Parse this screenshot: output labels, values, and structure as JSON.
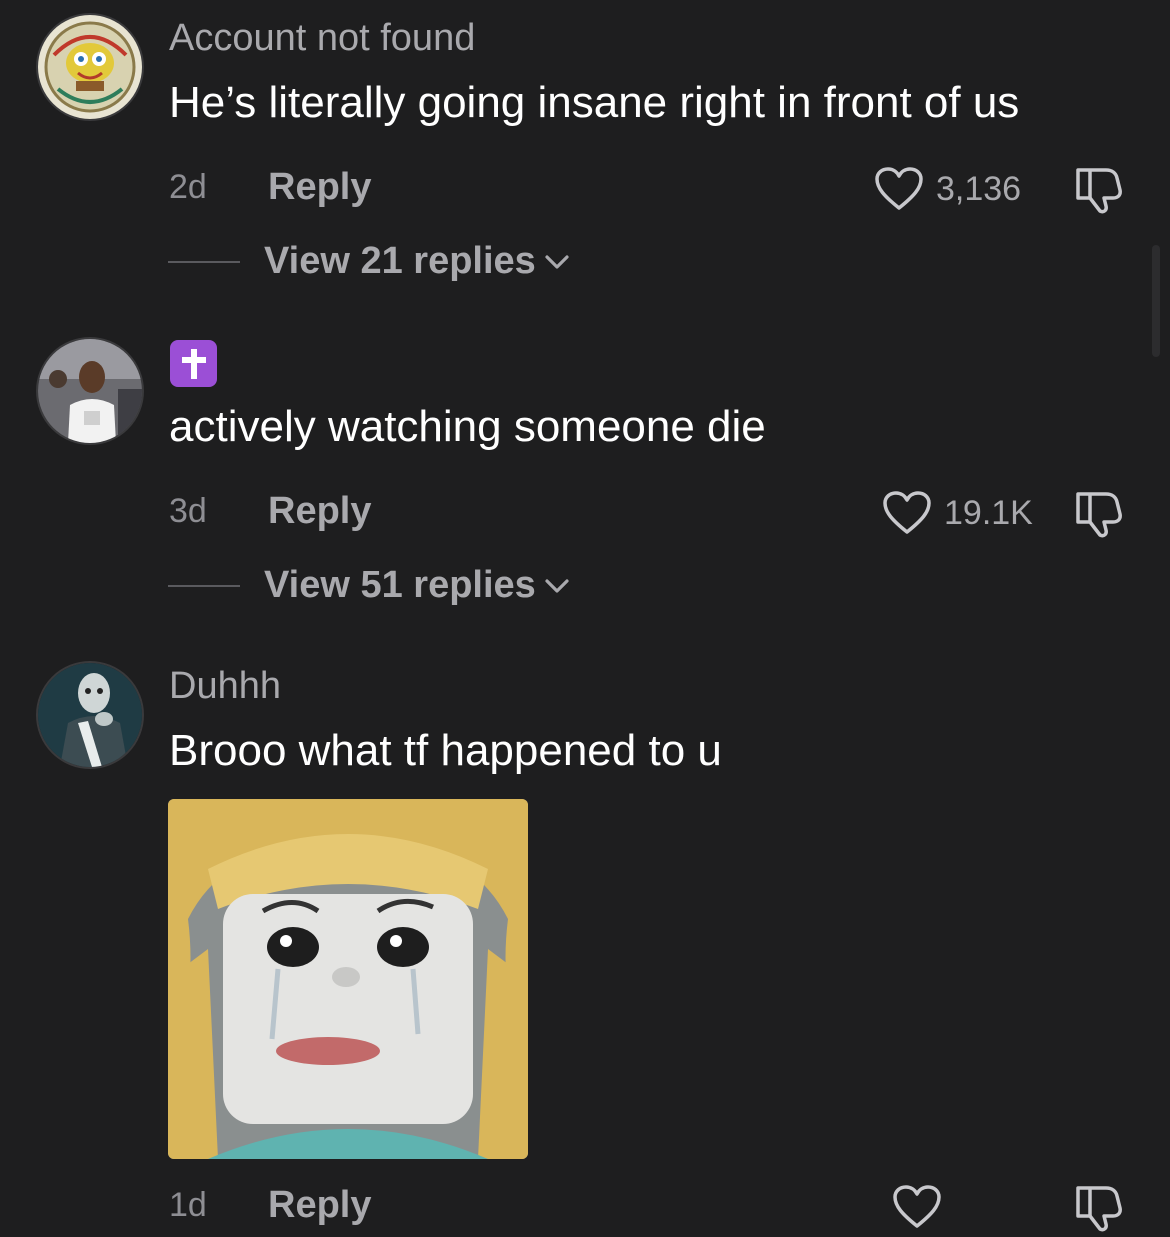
{
  "comments": [
    {
      "author": "Account not found",
      "text": "He’s literally going insane right in front of us",
      "time": "2d",
      "reply_label": "Reply",
      "likes": "3,136",
      "view_replies": "View 21 replies",
      "avatar": "spongebob-avatar"
    },
    {
      "author_emoji": "✝️",
      "text": "actively watching someone die",
      "time": "3d",
      "reply_label": "Reply",
      "likes": "19.1K",
      "view_replies": "View 51 replies",
      "avatar": "person-photo-avatar"
    },
    {
      "author": "Duhhh",
      "text": "Brooo what tf happened to u",
      "time": "1d",
      "reply_label": "Reply",
      "avatar": "anime-character-avatar",
      "attachment": "crying-roblox-character-image"
    }
  ],
  "icons": {
    "like": "heart-outline-icon",
    "dislike": "thumbs-down-icon",
    "expand": "chevron-down-icon"
  },
  "colors": {
    "background": "#1e1e1f",
    "primary_text": "#ffffff",
    "secondary_text": "#a9a9ad",
    "emoji_bg": "#9b4fd6"
  }
}
